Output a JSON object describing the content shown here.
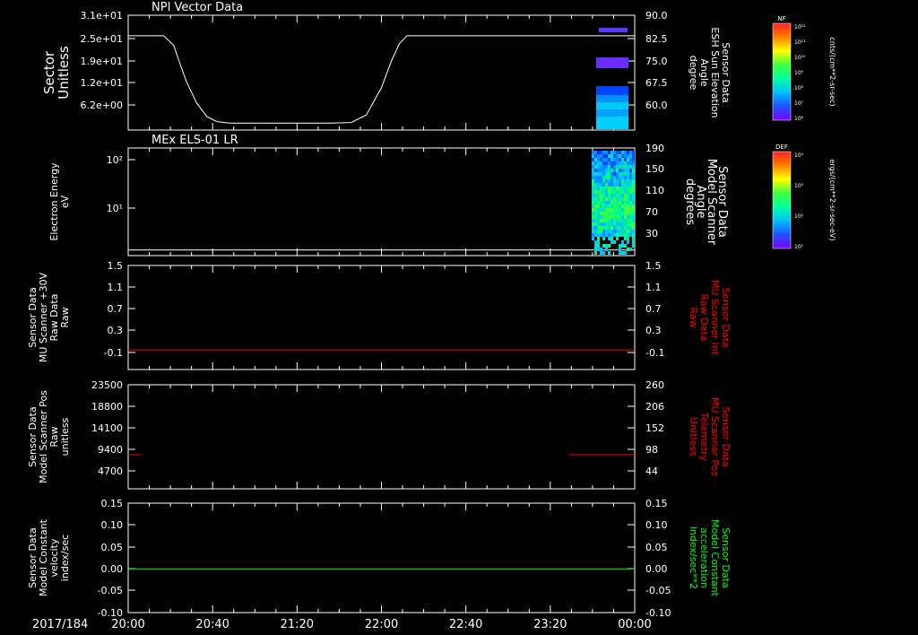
{
  "colors": {
    "background": "#000000",
    "axis": "#ffffff",
    "trace_white": "#ffffff",
    "trace_red": "#ff0000",
    "trace_green": "#00ff00"
  },
  "footer": {
    "date": "2017/184"
  },
  "x_axis": {
    "ticks": [
      "20:00",
      "20:40",
      "21:20",
      "22:00",
      "22:40",
      "23:20",
      "00:00"
    ]
  },
  "chart_data": [
    {
      "type": "line+heatmap",
      "title": "NPI Vector Data",
      "ylabel": [
        "Sector",
        "Unitless"
      ],
      "y_ticks_left": [
        "3.1e+01",
        "2.5e+01",
        "1.9e+01",
        "1.2e+01",
        "6.2e+00"
      ],
      "y2label": [
        "Sensor Data",
        "ESH Sun Elevation",
        "Angle",
        "degree"
      ],
      "y_ticks_right": [
        "90.0",
        "82.5",
        "75.0",
        "67.5",
        "60.0"
      ],
      "ylim_right": [
        52.0,
        90.0
      ],
      "series": [
        {
          "axis": "right",
          "color": "#ffffff",
          "points": [
            [
              0,
              83.2
            ],
            [
              0.07,
              83.2
            ],
            [
              0.09,
              80
            ],
            [
              0.1,
              75
            ],
            [
              0.115,
              68
            ],
            [
              0.135,
              61
            ],
            [
              0.155,
              56.5
            ],
            [
              0.175,
              54.8
            ],
            [
              0.2,
              54.3
            ],
            [
              0.4,
              54.3
            ],
            [
              0.44,
              54.5
            ],
            [
              0.47,
              57
            ],
            [
              0.5,
              66
            ],
            [
              0.52,
              75
            ],
            [
              0.535,
              80.5
            ],
            [
              0.55,
              83.2
            ],
            [
              1.0,
              83.2
            ]
          ]
        }
      ],
      "colorbar": {
        "label": "NF",
        "units": "cnts/(cm**2-sr-sec)",
        "ticks": [
          "10¹²",
          "10¹¹",
          "10¹⁰",
          "10⁹",
          "10⁸",
          "10⁷",
          "10⁶"
        ]
      }
    },
    {
      "type": "line+heatmap",
      "title": "MEx ELS-01 LR",
      "ylabel": [
        "Electron Energy",
        "eV"
      ],
      "y_ticks_left": [
        "10²",
        "10¹"
      ],
      "y2label": [
        "Sensor Data",
        "Model Scanner",
        "Angle",
        "degrees"
      ],
      "y_ticks_right": [
        "190",
        "150",
        "110",
        "70",
        "30"
      ],
      "ylim_right": [
        0,
        190
      ],
      "series": [
        {
          "axis": "right",
          "color": "#ffffff",
          "points": [
            [
              0,
              10
            ],
            [
              1,
              10
            ]
          ]
        }
      ],
      "colorbar": {
        "label": "DEF",
        "units": "ergs/(cm**2-sr-sec-eV)",
        "ticks": [
          "10⁴",
          "10³",
          "10²",
          "10¹"
        ]
      }
    },
    {
      "type": "line",
      "ylabel": [
        "Sensor Data",
        "MU Scanner +30V",
        "Raw Data",
        "Raw"
      ],
      "y_ticks_left": [
        "1.5",
        "1.1",
        "0.7",
        "0.3",
        "-0.1"
      ],
      "y2label": [
        "Sensor Data",
        "MU Scanner Int",
        "Raw Data",
        "Raw"
      ],
      "y_ticks_right": [
        "1.5",
        "1.1",
        "0.7",
        "0.3",
        "-0.1"
      ],
      "ylim_left": [
        -0.35,
        1.5
      ],
      "series": [
        {
          "axis": "left",
          "color": "#ff0000",
          "points": [
            [
              0,
              0.0
            ],
            [
              1,
              0.0
            ]
          ]
        }
      ]
    },
    {
      "type": "line",
      "ylabel": [
        "Sensor Data",
        "Model Scanner Pos",
        "Raw",
        "unitless"
      ],
      "y_ticks_left": [
        "23500",
        "18800",
        "14100",
        "9400",
        "4700"
      ],
      "y2label": [
        "Sensor Data",
        "MU Scanner Pos",
        "Telemetry",
        "Unitless"
      ],
      "y_ticks_right": [
        "260",
        "206",
        "152",
        "98",
        "44"
      ],
      "ylim_left": [
        0,
        23500
      ],
      "series": [
        {
          "axis": "left",
          "color": "#ff0000",
          "points": [
            [
              0,
              7700
            ],
            [
              0.025,
              7700
            ]
          ]
        },
        {
          "axis": "left",
          "color": "#ff0000",
          "points": [
            [
              0.87,
              7700
            ],
            [
              1,
              7700
            ]
          ]
        }
      ]
    },
    {
      "type": "line",
      "ylabel": [
        "Sensor Data",
        "Model Constant",
        "velocity",
        "index/sec"
      ],
      "y_ticks_left": [
        "0.15",
        "0.10",
        "0.05",
        "0.00",
        "-0.05",
        "-0.10"
      ],
      "y2label": [
        "Sensor Data",
        "Model Constant",
        "acceleration",
        "index/sec**2"
      ],
      "y_ticks_right": [
        "0.15",
        "0.10",
        "0.05",
        "0.00",
        "-0.05",
        "-0.10"
      ],
      "ylim_left": [
        -0.1,
        0.15
      ],
      "series": [
        {
          "axis": "left",
          "color": "#00ff00",
          "points": [
            [
              0,
              0.0
            ],
            [
              1,
              0.0
            ]
          ]
        }
      ]
    }
  ]
}
